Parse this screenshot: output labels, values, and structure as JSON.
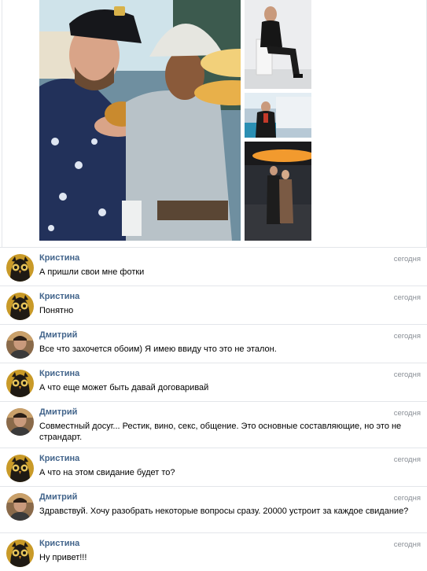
{
  "photos": {
    "main": "photo-two-men-street-food",
    "side": [
      "photo-man-seated-chair",
      "photo-man-poolside",
      "photo-couple-corridor"
    ]
  },
  "messages": [
    {
      "author": "Кристина",
      "date": "сегодня",
      "text": "А пришли свои мне фотки",
      "avatar": "owl-avatar"
    },
    {
      "author": "Кристина",
      "date": "сегодня",
      "text": "Понятно",
      "avatar": "owl-avatar"
    },
    {
      "author": "Дмитрий",
      "date": "сегодня",
      "text": "Все что захочется обоим) Я имею ввиду что это не эталон.",
      "avatar": "man-avatar"
    },
    {
      "author": "Кристина",
      "date": "сегодня",
      "text": "А что еще может быть давай договаривай",
      "avatar": "owl-avatar"
    },
    {
      "author": "Дмитрий",
      "date": "сегодня",
      "text": "Совместный досуг... Рестик, вино, секс, общение. Это основные составляющие, но это не страндарт.",
      "avatar": "man-avatar"
    },
    {
      "author": "Кристина",
      "date": "сегодня",
      "text": "А что на этом свидание будет то?",
      "avatar": "owl-avatar"
    },
    {
      "author": "Дмитрий",
      "date": "сегодня",
      "text": "Здравствуй. Хочу разобрать некоторые вопросы сразу. 20000 устроит за каждое свидание?",
      "avatar": "man-avatar"
    },
    {
      "author": "Кристина",
      "date": "сегодня",
      "text": "Ну привет!!!",
      "avatar": "owl-avatar"
    }
  ],
  "colors": {
    "author": "#42648b",
    "date": "#8a8f96",
    "divider": "#e3e6ea"
  }
}
